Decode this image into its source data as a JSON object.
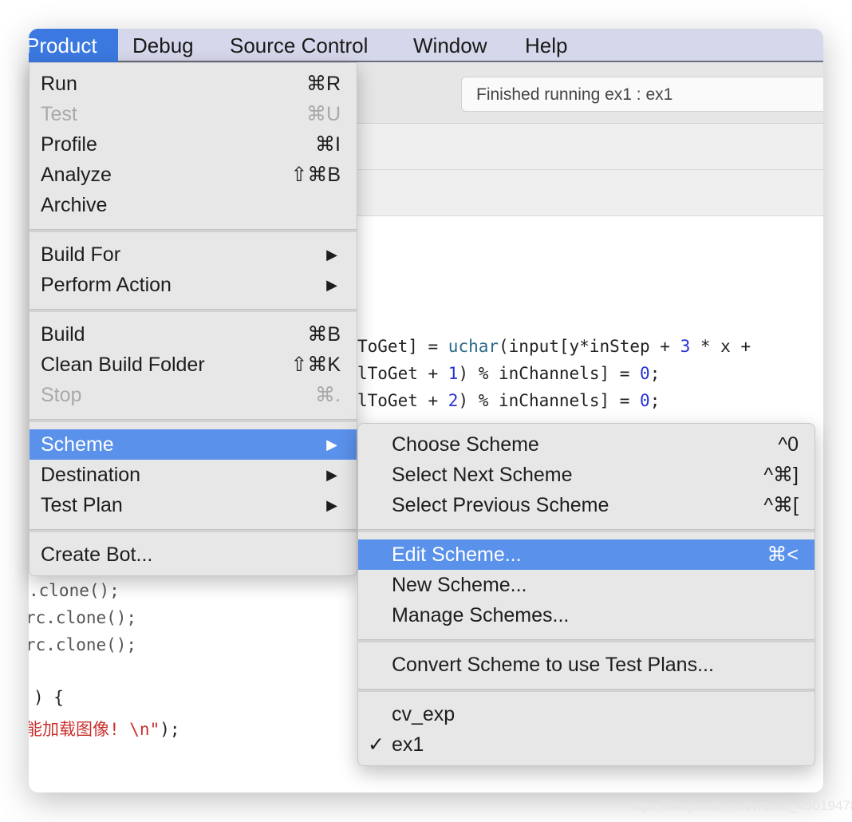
{
  "menubar": {
    "items": [
      "Product",
      "Debug",
      "Source Control",
      "Window",
      "Help"
    ],
    "active": "Product"
  },
  "toolbar": {
    "status": "Finished running ex1 : ex1"
  },
  "code": {
    "line1": {
      "a": "ToGet] = ",
      "fn": "uchar",
      "b": "(input[y*inStep + ",
      "num": "3",
      "c": " * x +"
    },
    "line2": {
      "a": "lToGet + ",
      "num": "1",
      "b": ") % inChannels] = ",
      "zero": "0",
      "c": ";"
    },
    "line3": {
      "a": "lToGet + ",
      "num": "2",
      "b": ") % inChannels] = ",
      "zero": "0",
      "c": ";"
    },
    "line4": ".clone();",
    "line5": "rc.clone();",
    "line6": "rc.clone();",
    "line7": ") {",
    "line8": {
      "str": "能加载图像! \\n\"",
      "c": ");"
    }
  },
  "product_menu": {
    "run": {
      "label": "Run",
      "shortcut": "⌘R"
    },
    "test": {
      "label": "Test",
      "shortcut": "⌘U"
    },
    "profile": {
      "label": "Profile",
      "shortcut": "⌘I"
    },
    "analyze": {
      "label": "Analyze",
      "shortcut": "⇧⌘B"
    },
    "archive": {
      "label": "Archive"
    },
    "build_for": {
      "label": "Build For"
    },
    "perform_action": {
      "label": "Perform Action"
    },
    "build": {
      "label": "Build",
      "shortcut": "⌘B"
    },
    "clean": {
      "label": "Clean Build Folder",
      "shortcut": "⇧⌘K"
    },
    "stop": {
      "label": "Stop",
      "shortcut": "⌘."
    },
    "scheme": {
      "label": "Scheme"
    },
    "destination": {
      "label": "Destination"
    },
    "test_plan": {
      "label": "Test Plan"
    },
    "create_bot": {
      "label": "Create Bot..."
    },
    "submenu_arrow": "▶"
  },
  "scheme_menu": {
    "choose": {
      "label": "Choose Scheme",
      "shortcut": "^0"
    },
    "next": {
      "label": "Select Next Scheme",
      "shortcut": "^⌘]"
    },
    "prev": {
      "label": "Select Previous Scheme",
      "shortcut": "^⌘["
    },
    "edit": {
      "label": "Edit Scheme...",
      "shortcut": "⌘<"
    },
    "new": {
      "label": "New Scheme..."
    },
    "manage": {
      "label": "Manage Schemes..."
    },
    "convert": {
      "label": "Convert Scheme to use Test Plans..."
    },
    "schemes": [
      "cv_exp",
      "ex1"
    ],
    "checked_scheme": "ex1",
    "check": "✓"
  },
  "colors": {
    "highlight": "#5a91ea",
    "menubar_active": "#3b78e0"
  },
  "watermark": "https://blog.csdn.net/weixin_45019478"
}
